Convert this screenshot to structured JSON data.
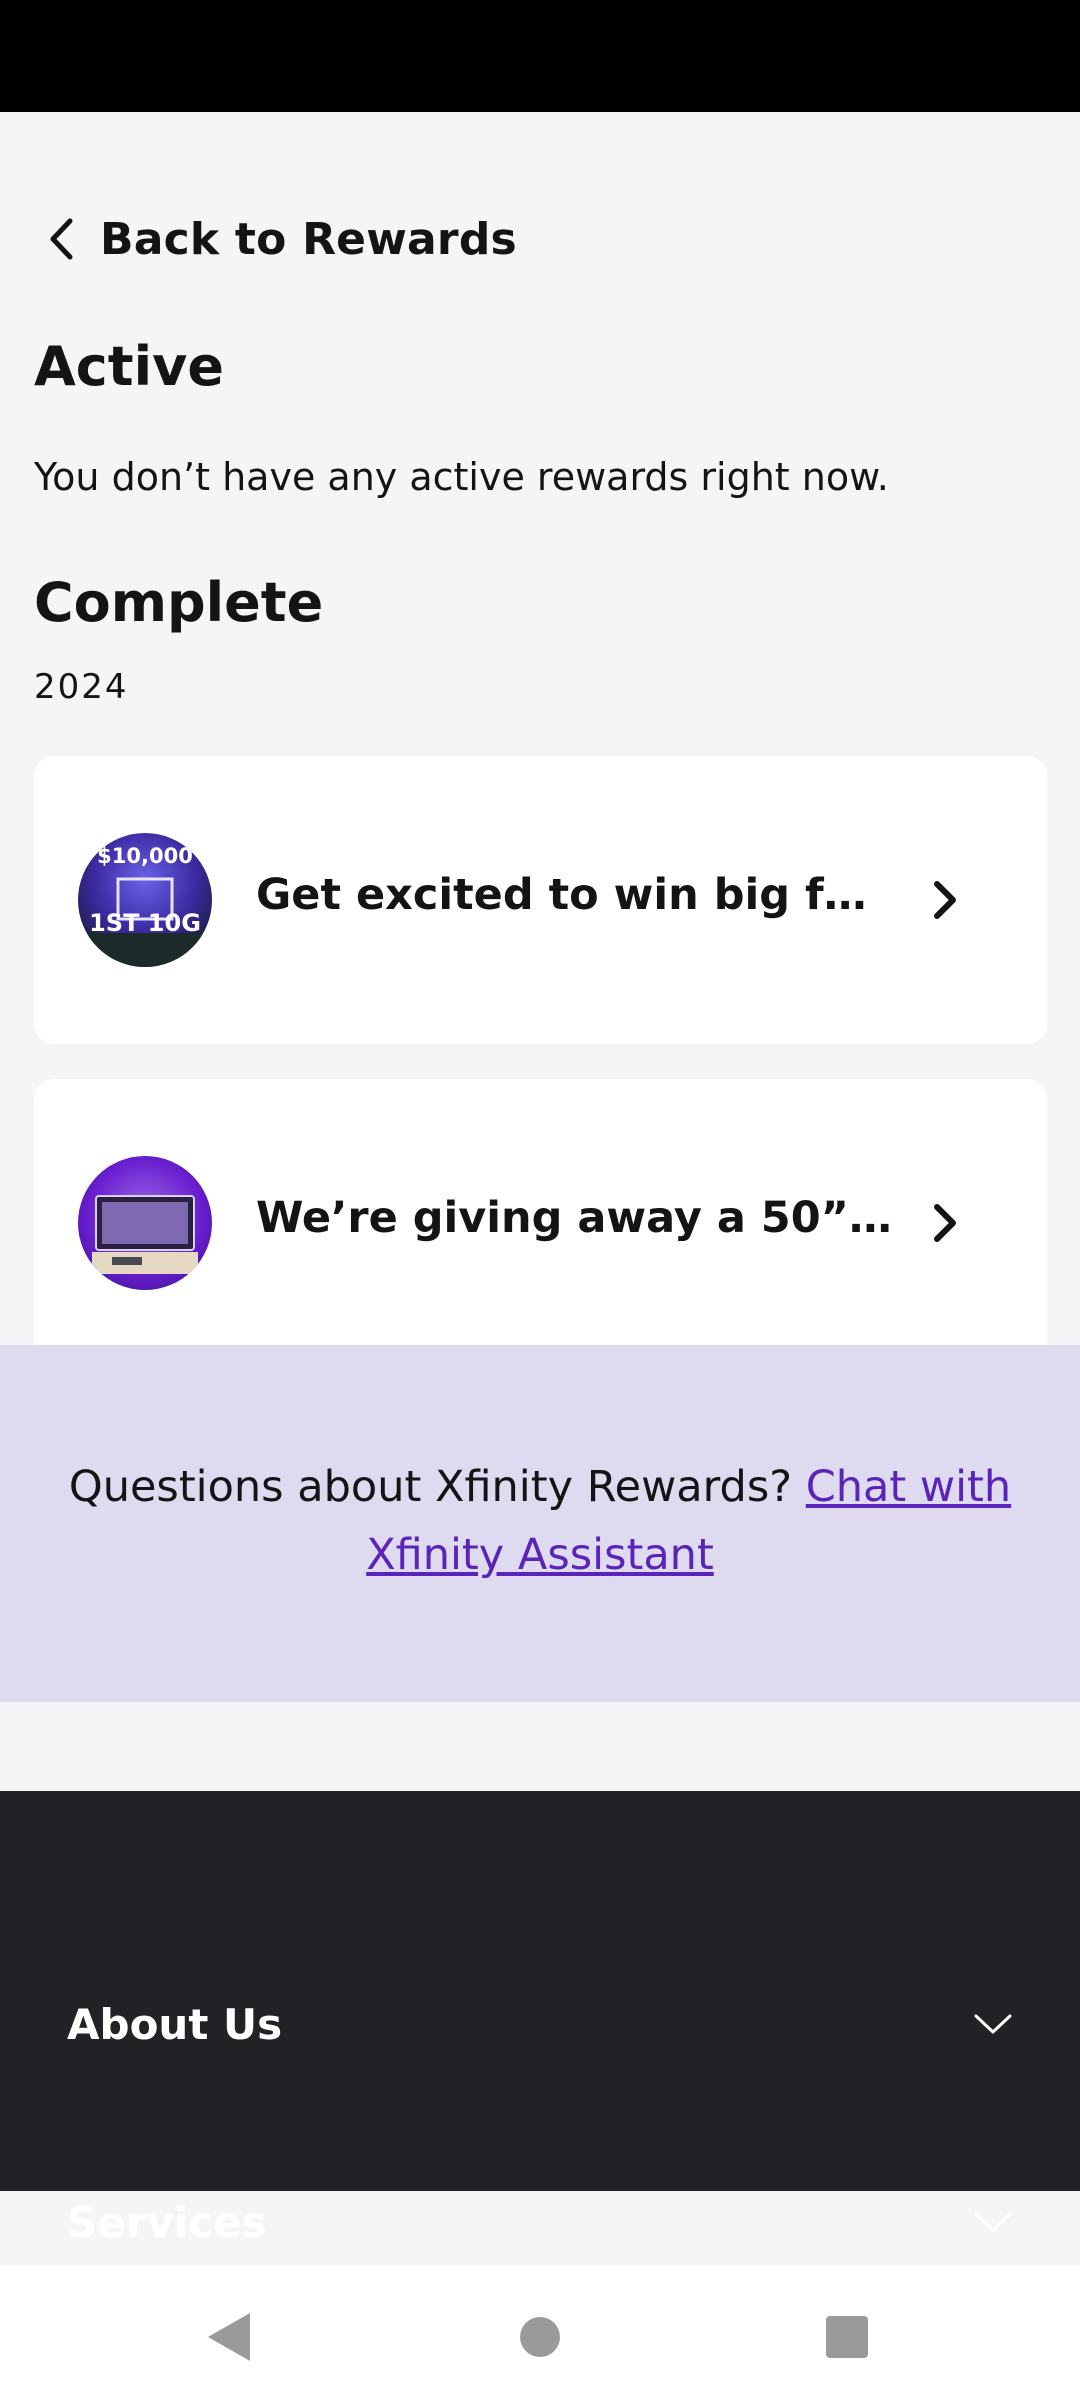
{
  "back": {
    "label": "Back to Rewards"
  },
  "active": {
    "heading": "Active",
    "empty_message": "You don’t have any active rewards right now."
  },
  "complete": {
    "heading": "Complete",
    "year": "2024",
    "rewards": [
      {
        "title": "Get excited to win big for th...",
        "thumbnail_text": [
          "$10,000",
          "1ST 10G"
        ]
      },
      {
        "title": "We’re giving away a 50” TV..."
      }
    ]
  },
  "help": {
    "text": "Questions about Xfinity Rewards? ",
    "link": "Chat with Xfinity Assistant"
  },
  "footer": {
    "items": [
      {
        "label": "About Us",
        "icon": "chevron-down-icon"
      },
      {
        "label": "Services",
        "icon": "chevron-down-icon"
      }
    ]
  },
  "system_nav": {
    "back": "back-triangle-icon",
    "home": "home-circle-icon",
    "recents": "recents-square-icon"
  },
  "colors": {
    "page_background": "#f5f5f7",
    "card_background": "#ffffff",
    "text": "#141417",
    "help_band": "#dedaf0",
    "link": "#5a23b9",
    "footer_background": "#222226",
    "footer_text": "#ffffff",
    "system_nav_icons": "#9a9a9a"
  }
}
